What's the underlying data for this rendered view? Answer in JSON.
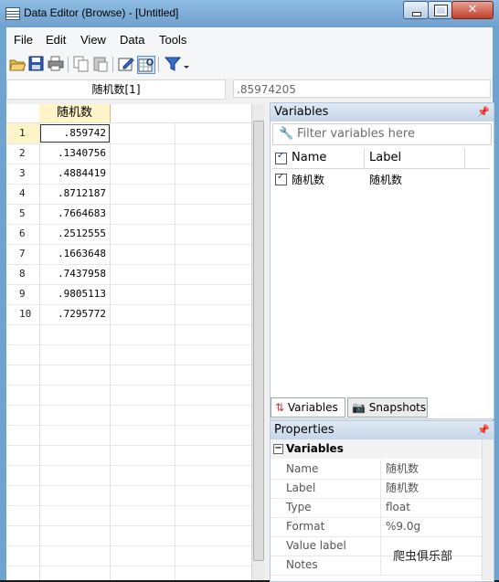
{
  "window": {
    "title": "Data Editor (Browse) - [Untitled]"
  },
  "menu": [
    "File",
    "Edit",
    "View",
    "Data",
    "Tools"
  ],
  "cellbar": {
    "name": "随机数[1]",
    "value": ".85974205"
  },
  "grid": {
    "column": "随机数",
    "rows": [
      {
        "n": "1",
        "v": ".859742"
      },
      {
        "n": "2",
        "v": ".1340756"
      },
      {
        "n": "3",
        "v": ".4884419"
      },
      {
        "n": "4",
        "v": ".8712187"
      },
      {
        "n": "5",
        "v": ".7664683"
      },
      {
        "n": "6",
        "v": ".2512555"
      },
      {
        "n": "7",
        "v": ".1663648"
      },
      {
        "n": "8",
        "v": ".7437958"
      },
      {
        "n": "9",
        "v": ".9805113"
      },
      {
        "n": "10",
        "v": ".7295772"
      }
    ]
  },
  "variables_panel": {
    "title": "Variables",
    "filter_placeholder": "Filter variables here",
    "headers": {
      "name": "Name",
      "label": "Label"
    },
    "items": [
      {
        "name": "随机数",
        "label": "随机数"
      }
    ],
    "tabs": [
      "Variables",
      "Snapshots"
    ]
  },
  "properties_panel": {
    "title": "Properties",
    "group": "Variables",
    "rows": [
      {
        "k": "Name",
        "v": "随机数"
      },
      {
        "k": "Label",
        "v": "随机数"
      },
      {
        "k": "Type",
        "v": "float"
      },
      {
        "k": "Format",
        "v": "%9.0g"
      },
      {
        "k": "Value label",
        "v": ""
      },
      {
        "k": "Notes",
        "v": ""
      }
    ]
  },
  "watermark": "爬虫俱乐部"
}
